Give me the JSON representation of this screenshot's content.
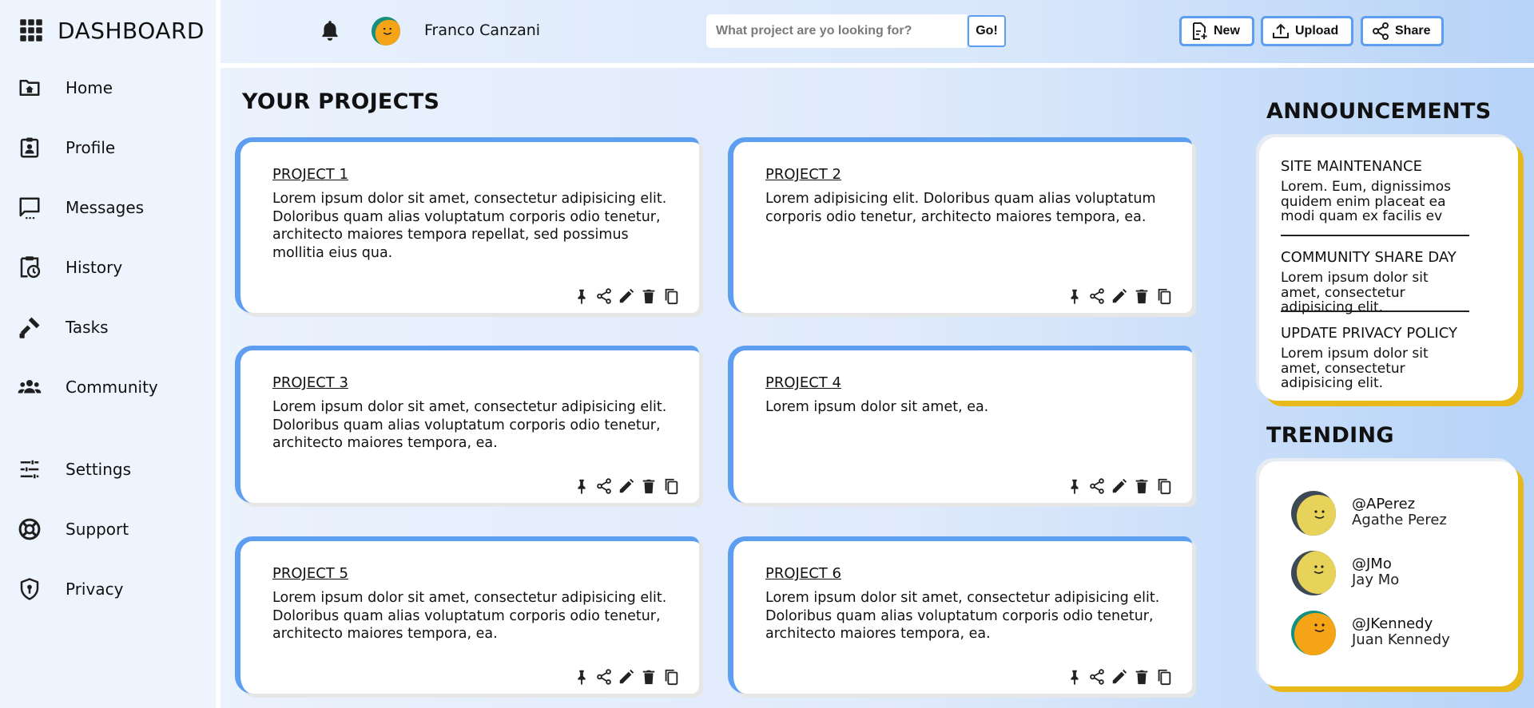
{
  "sidebar": {
    "brand": "DASHBOARD",
    "items": [
      {
        "label": "Home",
        "icon": "home-folder-icon"
      },
      {
        "label": "Profile",
        "icon": "profile-icon"
      },
      {
        "label": "Messages",
        "icon": "messages-icon"
      },
      {
        "label": "History",
        "icon": "history-icon"
      },
      {
        "label": "Tasks",
        "icon": "tasks-icon"
      },
      {
        "label": "Community",
        "icon": "community-icon"
      },
      {
        "label": "Settings",
        "icon": "settings-icon"
      },
      {
        "label": "Support",
        "icon": "support-icon"
      },
      {
        "label": "Privacy",
        "icon": "privacy-icon"
      }
    ]
  },
  "header": {
    "user_name": "Franco Canzani",
    "search": {
      "placeholder": "What project are yo looking for?",
      "value": ""
    },
    "go_label": "Go!",
    "buttons": {
      "new": "New",
      "upload": "Upload",
      "share": "Share"
    }
  },
  "projects": {
    "title": "YOUR PROJECTS",
    "items": [
      {
        "title": "PROJECT 1",
        "body": "Lorem ipsum dolor sit amet, consectetur adipisicing elit. Doloribus quam alias voluptatum corporis odio tenetur, architecto maiores tempora repellat, sed possimus mollitia eius qua."
      },
      {
        "title": "PROJECT 2",
        "body": "Lorem adipisicing elit. Doloribus quam alias voluptatum corporis odio tenetur, architecto maiores tempora, ea."
      },
      {
        "title": "PROJECT 3",
        "body": "Lorem ipsum dolor sit amet, consectetur adipisicing elit. Doloribus quam alias voluptatum corporis odio tenetur, architecto maiores tempora, ea."
      },
      {
        "title": "PROJECT 4",
        "body": "Lorem ipsum dolor sit amet, ea."
      },
      {
        "title": "PROJECT 5",
        "body": "Lorem ipsum dolor sit amet, consectetur adipisicing elit. Doloribus quam alias voluptatum corporis odio tenetur, architecto maiores tempora, ea."
      },
      {
        "title": "PROJECT 6",
        "body": "Lorem ipsum dolor sit amet, consectetur adipisicing elit. Doloribus quam alias voluptatum corporis odio tenetur, architecto maiores tempora, ea."
      }
    ],
    "card_action_icons": [
      "pin-icon",
      "share-icon",
      "edit-icon",
      "delete-icon",
      "copy-icon"
    ]
  },
  "announcements": {
    "title": "ANNOUNCEMENTS",
    "items": [
      {
        "title": "SITE MAINTENANCE",
        "text": "Lorem. Eum, dignissimos quidem enim placeat ea modi quam ex facilis ev"
      },
      {
        "title": "COMMUNITY SHARE DAY",
        "text": "Lorem ipsum dolor sit amet, consectetur adipisicing elit."
      },
      {
        "title": "UPDATE PRIVACY POLICY",
        "text": "Lorem ipsum dolor sit amet, consectetur adipisicing elit."
      }
    ]
  },
  "trending": {
    "title": "TRENDING",
    "users": [
      {
        "handle": "@APerez",
        "name": "Agathe Perez"
      },
      {
        "handle": "@JMo",
        "name": "Jay Mo"
      },
      {
        "handle": "@JKennedy",
        "name": "Juan Kennedy"
      }
    ]
  },
  "colors": {
    "accent_blue": "#5d9ef0",
    "accent_yellow": "#e9b81a",
    "avatar_yellow": "#e8d35a",
    "avatar_orange": "#f6a417",
    "avatar_teal": "#15907f",
    "avatar_slate": "#3d4a56"
  }
}
